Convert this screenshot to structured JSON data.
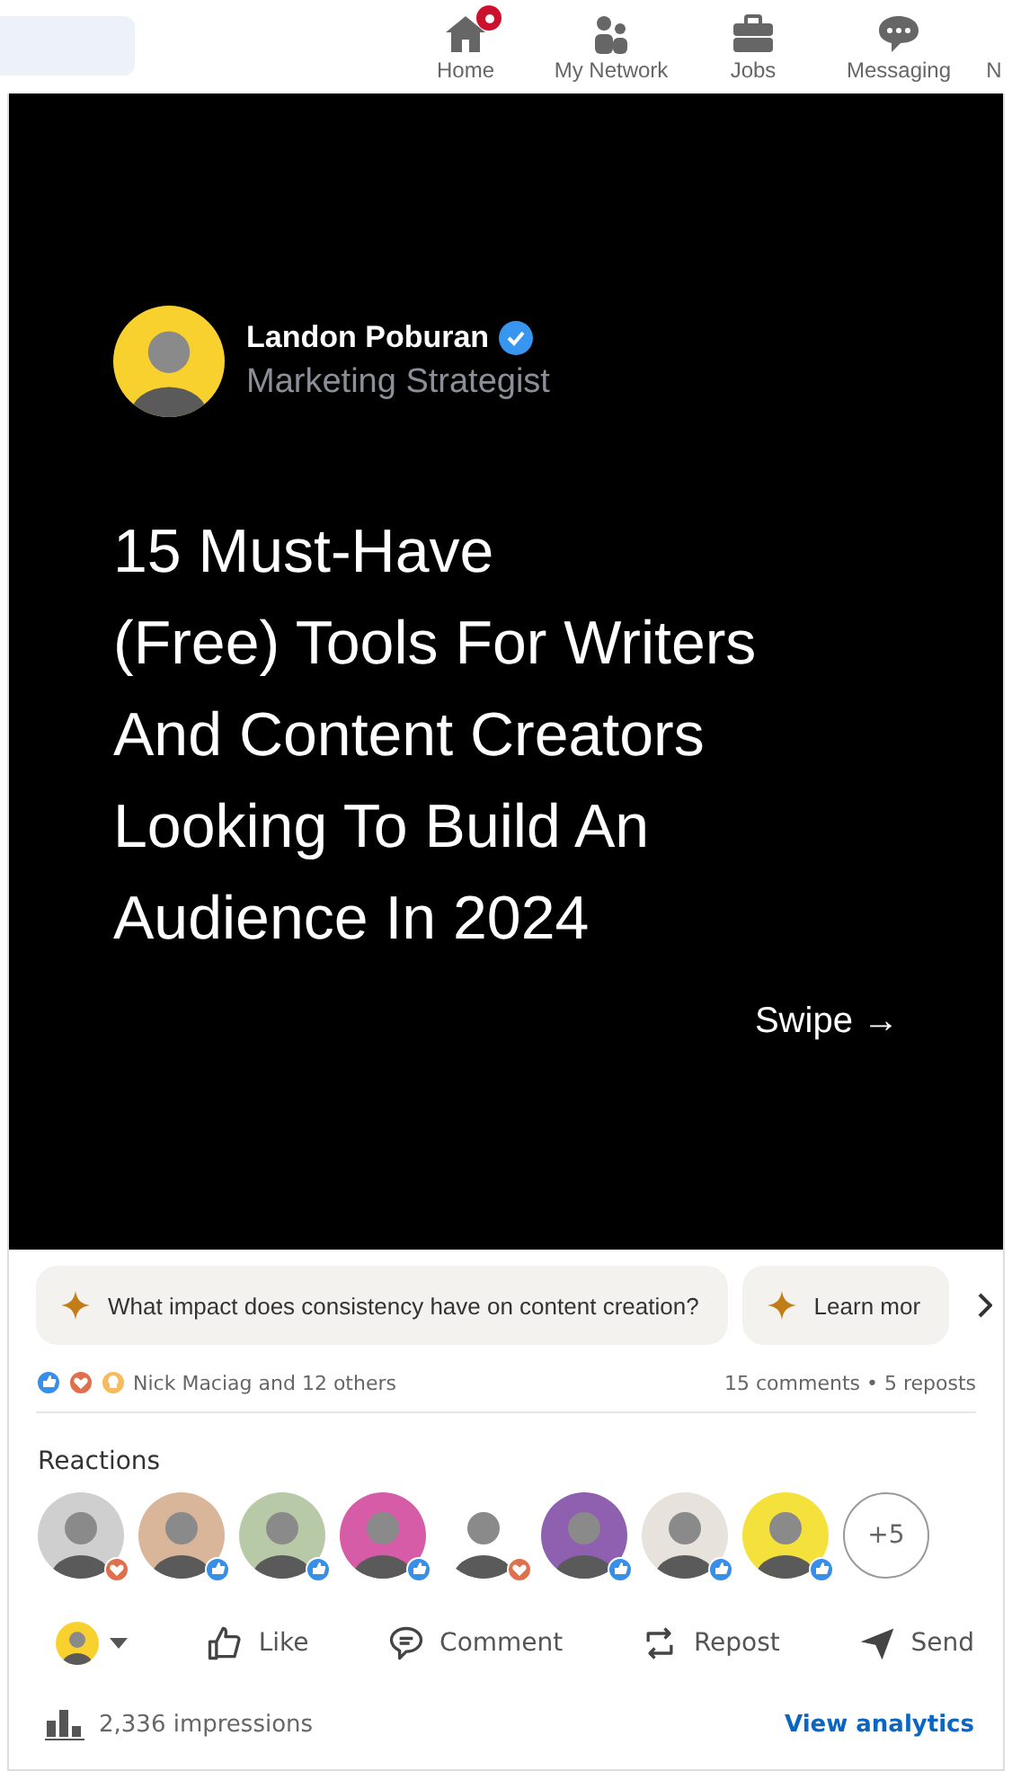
{
  "nav": {
    "items": [
      {
        "label": "Home",
        "kind": "home",
        "badge": true
      },
      {
        "label": "My Network",
        "kind": "network",
        "badge": false
      },
      {
        "label": "Jobs",
        "kind": "jobs",
        "badge": false
      },
      {
        "label": "Messaging",
        "kind": "messaging",
        "badge": false
      },
      {
        "label": "N",
        "kind": "cut",
        "badge": false
      }
    ]
  },
  "slide": {
    "author": "Landon Poburan",
    "verified": true,
    "headline": "Marketing Strategist",
    "title_lines": [
      "15 Must-Have",
      "(Free) Tools For Writers",
      "And Content Creators",
      "Looking To Build An",
      "Audience In 2024"
    ],
    "swipe": "Swipe →"
  },
  "suggestions": [
    {
      "text": "What impact does consistency have on content creation?"
    },
    {
      "text": "Learn mor"
    }
  ],
  "social": {
    "reactors": "Nick Maciag and 12 others",
    "counts": "15 comments • 5 reposts"
  },
  "reactions": {
    "title": "Reactions",
    "people": [
      {
        "kind": "love"
      },
      {
        "kind": "like"
      },
      {
        "kind": "like"
      },
      {
        "kind": "like"
      },
      {
        "kind": "love"
      },
      {
        "kind": "like"
      },
      {
        "kind": "like"
      },
      {
        "kind": "like"
      }
    ],
    "more": "+5"
  },
  "actions": [
    {
      "label": "Like",
      "kind": "like"
    },
    {
      "label": "Comment",
      "kind": "comment"
    },
    {
      "label": "Repost",
      "kind": "repost"
    },
    {
      "label": "Send",
      "kind": "send"
    }
  ],
  "footer": {
    "impressions": "2,336 impressions",
    "link": "View analytics"
  }
}
